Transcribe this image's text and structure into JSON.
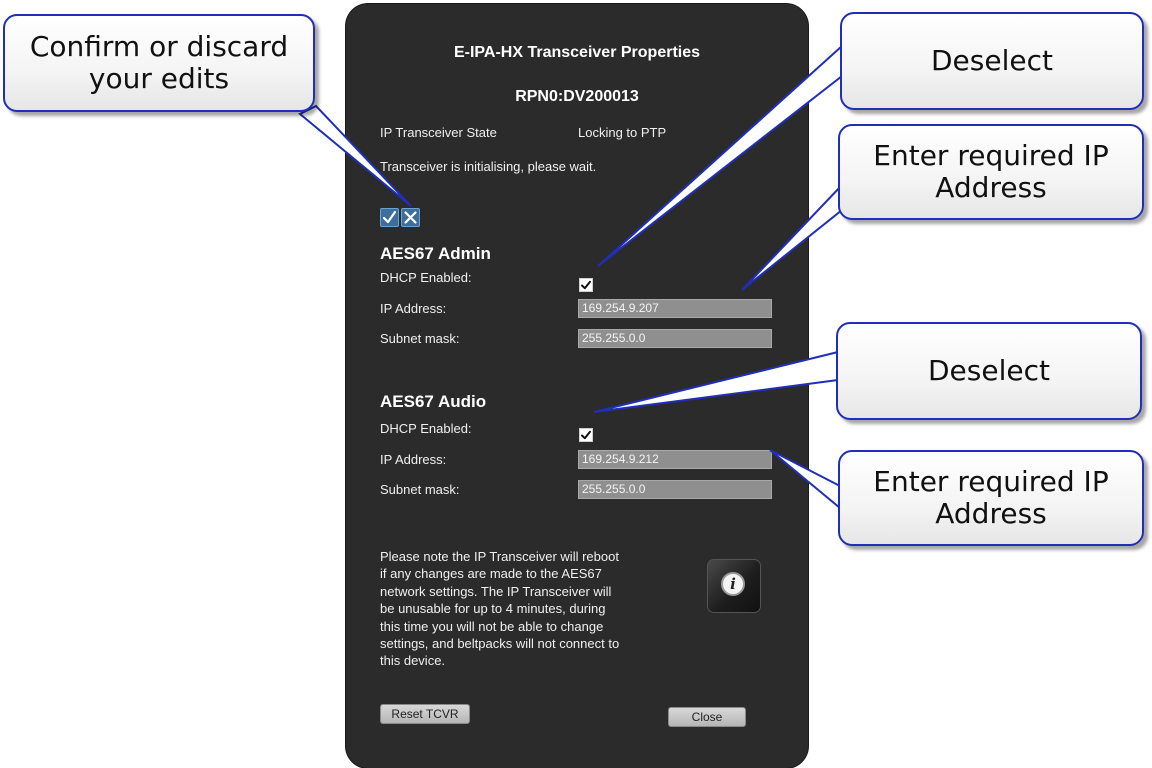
{
  "dialog": {
    "title": "E-IPA-HX Transceiver Properties",
    "device_id": "RPN0:DV200013",
    "state_label": "IP Transceiver State",
    "state_value": "Locking to PTP",
    "status_message": "Transceiver is initialising, please wait.",
    "confirm_icon": "checkmark-icon",
    "discard_icon": "close-icon",
    "admin": {
      "heading": "AES67 Admin",
      "dhcp_label": "DHCP Enabled:",
      "dhcp_checked": true,
      "ip_label": "IP Address:",
      "ip_value": "169.254.9.207",
      "subnet_label": "Subnet mask:",
      "subnet_value": "255.255.0.0"
    },
    "audio": {
      "heading": "AES67 Audio",
      "dhcp_label": "DHCP Enabled:",
      "dhcp_checked": true,
      "ip_label": "IP Address:",
      "ip_value": "169.254.9.212",
      "subnet_label": "Subnet mask:",
      "subnet_value": "255.255.0.0"
    },
    "note_lines": [
      "Please note the IP Transceiver will reboot",
      "if any changes are made to the AES67",
      "network settings. The IP Transceiver will",
      "be unusable for up to 4 minutes, during",
      "this time you will not be able to change",
      "settings, and beltpacks will not connect to",
      "this device."
    ],
    "info_icon": "info-icon",
    "reset_button": "Reset TCVR",
    "close_button": "Close"
  },
  "callouts": {
    "confirm": [
      "Confirm or discard",
      "your edits"
    ],
    "deselect_admin": "Deselect",
    "ip_admin": [
      "Enter required IP",
      "Address"
    ],
    "deselect_audio": "Deselect",
    "ip_audio": [
      "Enter required IP",
      "Address"
    ]
  },
  "colors": {
    "panel_bg": "#2b2b2b",
    "callout_border": "#1f2fb8",
    "field_bg": "#8f8f8f",
    "icon_button_bg": "#3d6f9c"
  }
}
